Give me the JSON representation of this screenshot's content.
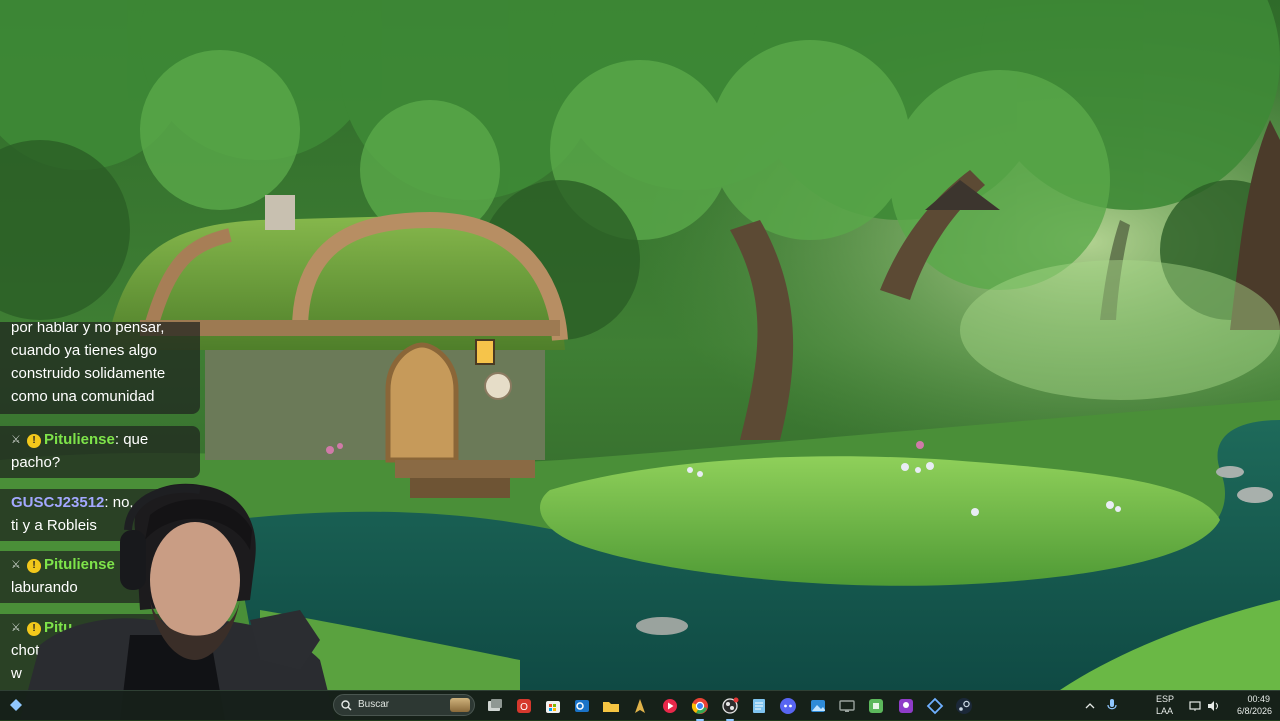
{
  "chat": {
    "messages": [
      {
        "text_lines": [
          "por hablar y no pensar,",
          "cuando ya tienes algo",
          "construido solidamente",
          "como una comunidad"
        ]
      },
      {
        "user": "Pituliense",
        "user_color": "#7ee34a",
        "separator": ":",
        "text_after_user": " que",
        "text_line2": "pacho?"
      },
      {
        "user": "GUSCJ23512",
        "user_color": "#a3a8ff",
        "separator": ":",
        "text_after_user": " no, sol",
        "text_line2": "ti y a Robleis"
      },
      {
        "user": "Pituliense",
        "user_color": "#7ee34a",
        "separator": "",
        "text_after_user": "",
        "text_line2": "laburando"
      },
      {
        "user": "Pitu",
        "user_color": "#7ee34a",
        "separator": "",
        "text_after_user": "",
        "text_line2": "chot",
        "text_line3": "w"
      }
    ]
  },
  "taskbar": {
    "search_placeholder": "Buscar",
    "apps": [
      "files-icon",
      "office-icon",
      "store-icon",
      "outlook-icon",
      "explorer-icon",
      "edge-dev-icon",
      "media-icon",
      "chrome-icon",
      "obs-icon",
      "notepad-icon",
      "discord-icon",
      "photos-icon",
      "remote-icon",
      "app-green-icon",
      "app-purple-icon",
      "app-blue-icon",
      "steam-icon"
    ],
    "language_line1": "ESP",
    "language_line2": "LAA",
    "time": "00:49",
    "date": "6/8/2026"
  },
  "colors": {
    "accent": "#8fc7ff",
    "taskbar_bg": "#16201a",
    "mod_green": "#7ee34a"
  }
}
